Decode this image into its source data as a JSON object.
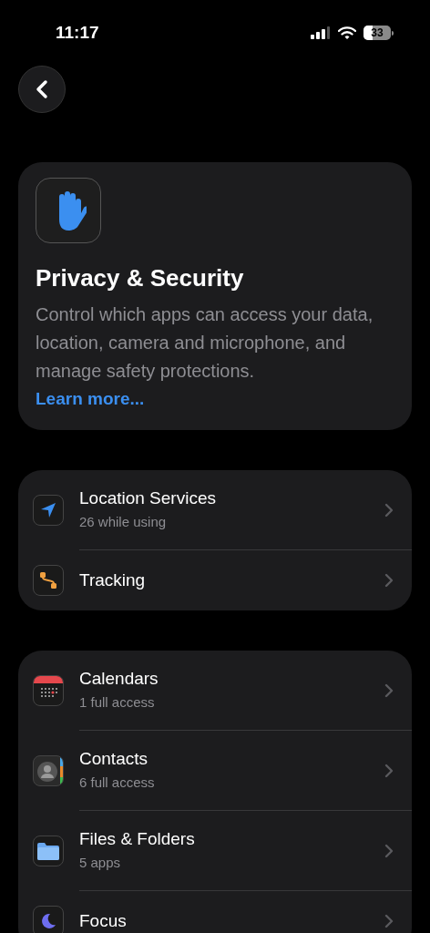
{
  "status_bar": {
    "time": "11:17",
    "battery": "33"
  },
  "header_card": {
    "title": "Privacy & Security",
    "description": "Control which apps can access your data, location, camera and microphone, and manage safety protections.",
    "link": "Learn more..."
  },
  "groups": [
    {
      "rows": [
        {
          "title": "Location Services",
          "subtitle": "26 while using"
        },
        {
          "title": "Tracking"
        }
      ]
    },
    {
      "rows": [
        {
          "title": "Calendars",
          "subtitle": "1 full access"
        },
        {
          "title": "Contacts",
          "subtitle": "6 full access"
        },
        {
          "title": "Files & Folders",
          "subtitle": "5 apps"
        },
        {
          "title": "Focus"
        }
      ]
    }
  ]
}
